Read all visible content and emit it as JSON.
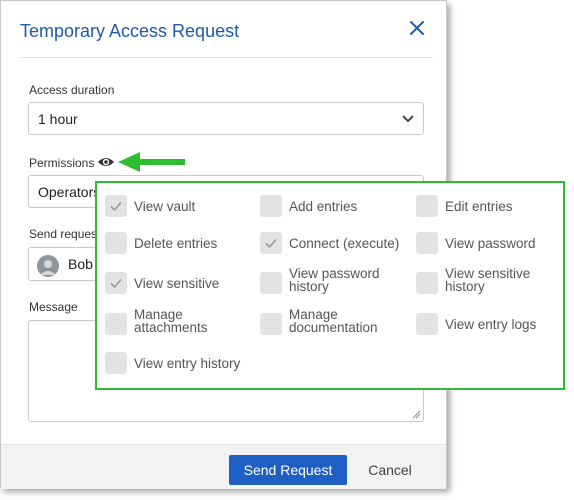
{
  "dialog": {
    "title": "Temporary Access Request",
    "close_icon": "close-icon"
  },
  "access_duration": {
    "label": "Access duration",
    "value": "1 hour"
  },
  "permissions": {
    "label": "Permissions",
    "selected_value": "Operators",
    "eye_icon": "eye-icon",
    "arrow_color": "#2ebd2e"
  },
  "send_request": {
    "label": "Send request",
    "user": "Bob"
  },
  "message": {
    "label": "Message",
    "value": ""
  },
  "permission_panel": {
    "border_color": "#2ebd2e",
    "items": [
      {
        "label": "View vault",
        "checked": true
      },
      {
        "label": "Add entries",
        "checked": false
      },
      {
        "label": "Edit entries",
        "checked": false
      },
      {
        "label": "Delete entries",
        "checked": false
      },
      {
        "label": "Connect (execute)",
        "checked": true
      },
      {
        "label": "View password",
        "checked": false
      },
      {
        "label": "View sensitive",
        "checked": true
      },
      {
        "label": "View password\nhistory",
        "checked": false
      },
      {
        "label": "View sensitive\nhistory",
        "checked": false
      },
      {
        "label": "Manage\nattachments",
        "checked": false
      },
      {
        "label": "Manage\ndocumentation",
        "checked": false
      },
      {
        "label": "View entry logs",
        "checked": false
      },
      {
        "label": "View entry history",
        "checked": false
      }
    ]
  },
  "footer": {
    "send_label": "Send Request",
    "cancel_label": "Cancel",
    "primary_color": "#1f5ec2"
  }
}
